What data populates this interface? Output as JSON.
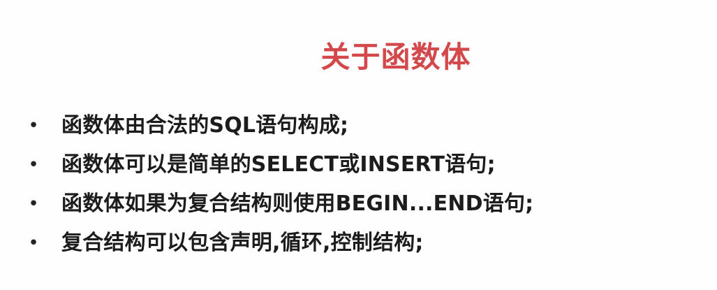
{
  "slide": {
    "title": "关于函数体",
    "bullet_symbol": "•",
    "bullets": [
      "函数体由合法的SQL语句构成;",
      "函数体可以是简单的SELECT或INSERT语句;",
      "函数体如果为复合结构则使用BEGIN...END语句;",
      "复合结构可以包含声明,循环,控制结构;"
    ]
  },
  "colors": {
    "title": "#d3484b",
    "text": "#1c1c1c",
    "background": "#fefefe"
  }
}
